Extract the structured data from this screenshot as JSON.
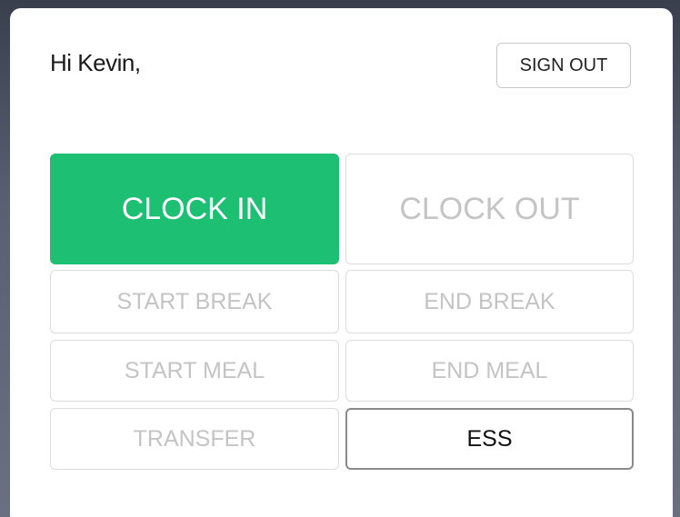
{
  "header": {
    "greeting": "Hi Kevin,",
    "sign_out_label": "SIGN OUT"
  },
  "actions": {
    "clock_in": "CLOCK IN",
    "clock_out": "CLOCK OUT",
    "start_break": "START BREAK",
    "end_break": "END BREAK",
    "start_meal": "START MEAL",
    "end_meal": "END MEAL",
    "transfer": "TRANSFER",
    "ess": "ESS"
  },
  "colors": {
    "primary_green": "#1dbf73",
    "disabled_text": "#c4c4c4"
  }
}
